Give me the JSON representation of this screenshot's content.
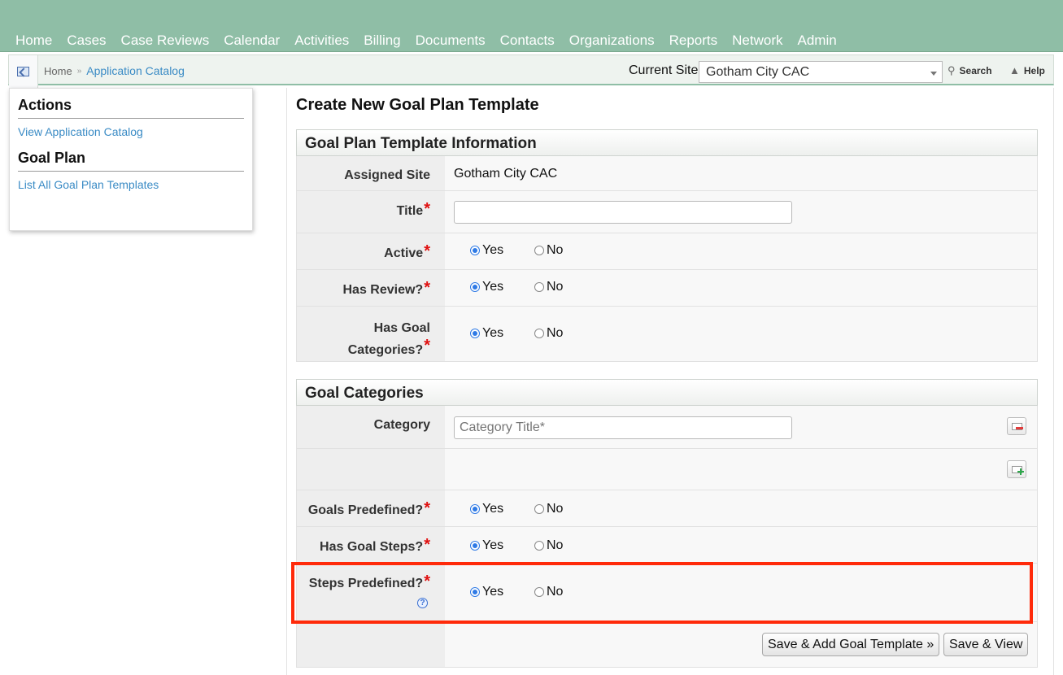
{
  "nav": {
    "items": [
      "Home",
      "Cases",
      "Case Reviews",
      "Calendar",
      "Activities",
      "Billing",
      "Documents",
      "Contacts",
      "Organizations",
      "Reports",
      "Network",
      "Admin"
    ]
  },
  "breadcrumb": {
    "home": "Home",
    "separator": "»",
    "current": "Application Catalog"
  },
  "site": {
    "label": "Current Site",
    "selected": "Gotham City CAC"
  },
  "tools": {
    "search": "Search",
    "help": "Help"
  },
  "sidebar": {
    "actions_title": "Actions",
    "actions_link": "View Application Catalog",
    "goal_plan_title": "Goal Plan",
    "goal_plan_link": "List All Goal Plan Templates"
  },
  "page": {
    "title": "Create New Goal Plan Template"
  },
  "info_panel": {
    "title": "Goal Plan Template Information",
    "assigned_site_label": "Assigned Site",
    "assigned_site_value": "Gotham City CAC",
    "title_label": "Title",
    "title_value": "",
    "active_label": "Active",
    "has_review_label": "Has Review?",
    "has_goal_categories_label_1": "Has Goal",
    "has_goal_categories_label_2": "Categories?"
  },
  "categories_panel": {
    "title": "Goal Categories",
    "category_label": "Category",
    "category_placeholder": "Category Title*",
    "goals_predefined_label": "Goals Predefined?",
    "has_goal_steps_label": "Has Goal Steps?",
    "steps_predefined_label": "Steps Predefined?"
  },
  "radio": {
    "yes": "Yes",
    "no": "No"
  },
  "required_mark": "*",
  "help_glyph": "?",
  "buttons": {
    "save_add": "Save & Add Goal Template »",
    "save_view": "Save & View"
  },
  "colors": {
    "nav_bg": "#8fbea6",
    "link": "#3a8bc5",
    "required": "#e01010",
    "highlight": "#ff2a0a"
  }
}
